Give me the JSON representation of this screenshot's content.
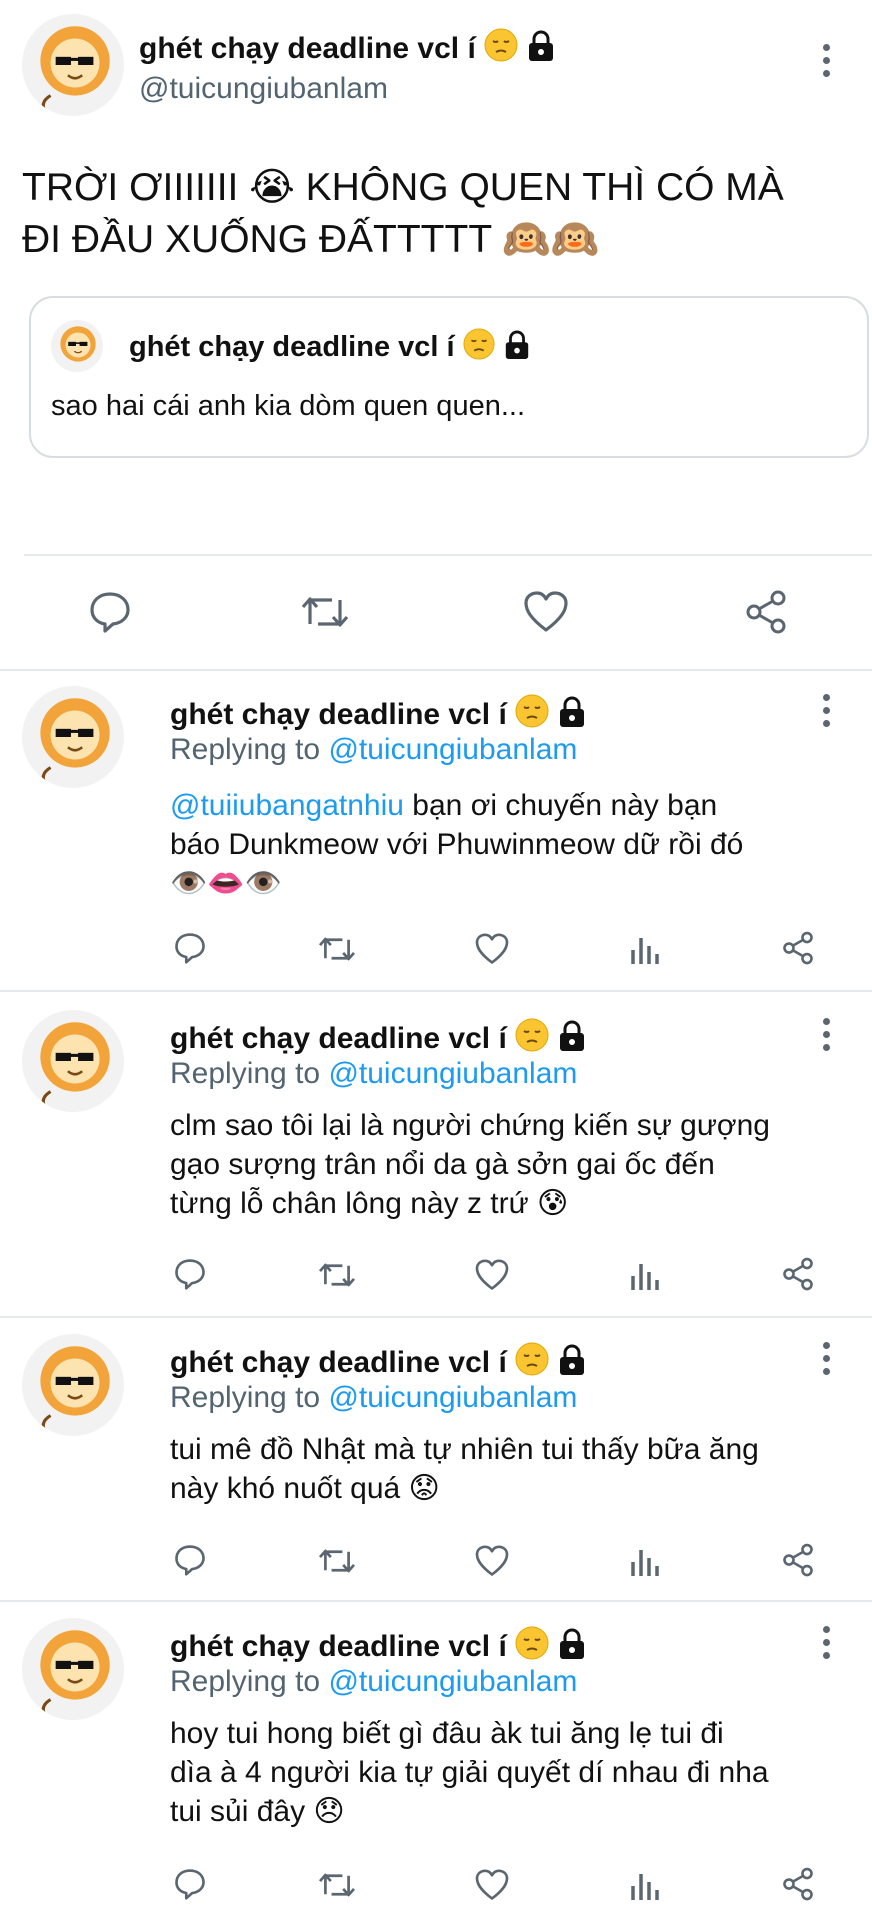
{
  "main_tweet": {
    "author_name": "ghét chạy deadline vcl í",
    "author_handle": "@tuicungiubanlam",
    "text_line1": "TRỜI ƠIIIIIII 😭 KHÔNG QUEN THÌ CÓ MÀ",
    "text_line2": "ĐI ĐẦU XUỐNG ĐẤTTTTT 🙉🙉",
    "name_emoji": "pensive-face",
    "name_badge": "lock-icon",
    "quoted": {
      "author_name": "ghét chạy deadline vcl í",
      "text": "sao hai cái anh kia dòm quen quen..."
    }
  },
  "replies": [
    {
      "author_name": "ghét chạy deadline vcl í",
      "replying_label": "Replying to",
      "replying_to": "@tuicungiubanlam",
      "mention": "@tuiiubangatnhiu",
      "lines": [
        " bạn ơi chuyến này bạn",
        "báo Dunkmeow với Phuwinmeow dữ rồi đó",
        "👁️👄👁️"
      ]
    },
    {
      "author_name": "ghét chạy deadline vcl í",
      "replying_label": "Replying to",
      "replying_to": "@tuicungiubanlam",
      "lines": [
        "clm sao tôi lại là người chứng kiến sự gượng",
        "gạo sượng trân nổi da gà sởn gai ốc đến",
        "từng lỗ chân lông này z trứ 😰"
      ]
    },
    {
      "author_name": "ghét chạy deadline vcl í",
      "replying_label": "Replying to",
      "replying_to": "@tuicungiubanlam",
      "lines": [
        "tui mê đồ Nhật mà tự nhiên tui thấy bữa ăng",
        "này khó nuốt quá 😟"
      ]
    },
    {
      "author_name": "ghét chạy deadline vcl í",
      "replying_label": "Replying to",
      "replying_to": "@tuicungiubanlam",
      "lines": [
        "hoy tui hong biết gì đâu àk tui ăng lẹ tui đi",
        "dìa à 4 người kia tự giải quyết dí nhau đi nha",
        "tui sủi đây 😞"
      ]
    }
  ],
  "colors": {
    "link": "#1d9bf0",
    "secondary_text": "#536471",
    "icon": "#5b6670",
    "divider": "#e6e9ec"
  }
}
